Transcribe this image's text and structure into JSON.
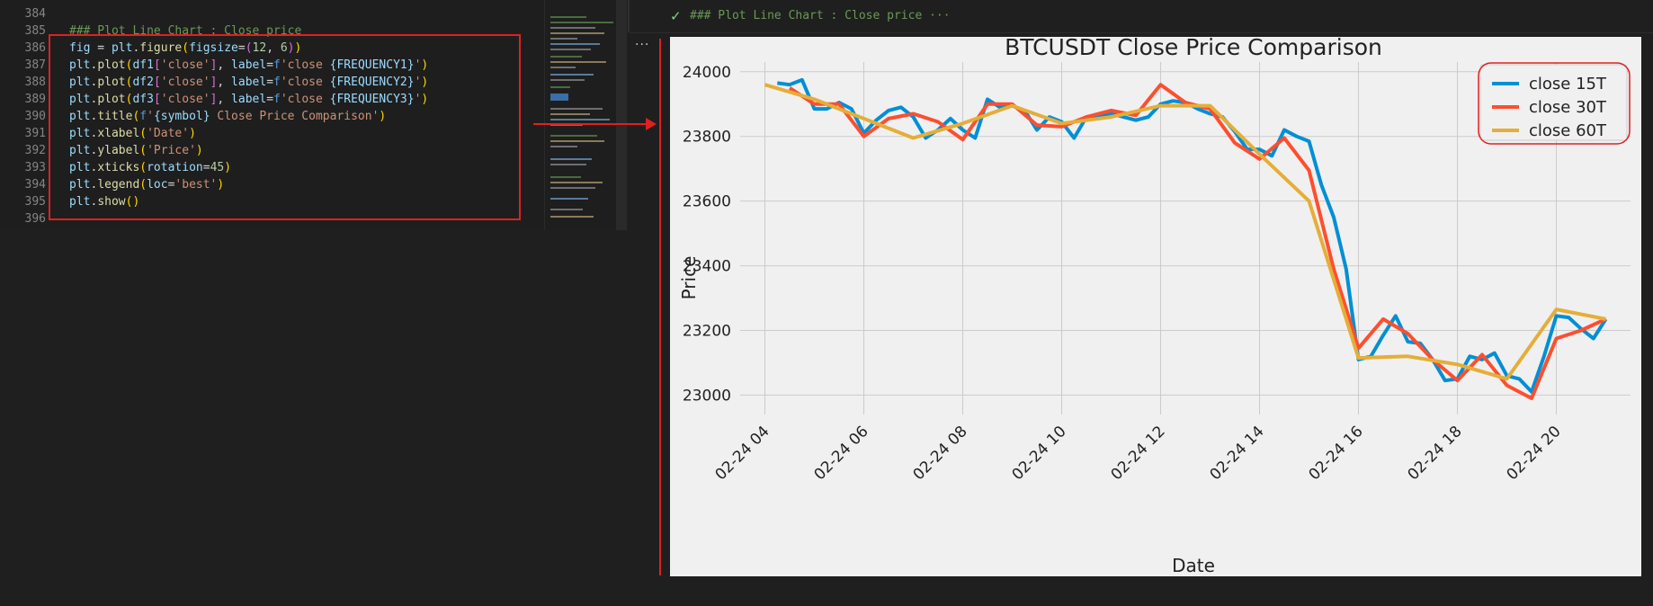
{
  "editor": {
    "lines": [
      {
        "num": "384",
        "tokens": []
      },
      {
        "num": "385",
        "tokens": [
          {
            "t": "### Plot Line Chart : Close price",
            "c": "c-comment"
          }
        ]
      },
      {
        "num": "386",
        "tokens": [
          {
            "t": "fig",
            "c": "c-var"
          },
          {
            "t": " = ",
            "c": "c-punc"
          },
          {
            "t": "plt",
            "c": "c-var"
          },
          {
            "t": ".",
            "c": "c-punc"
          },
          {
            "t": "figure",
            "c": "c-fn"
          },
          {
            "t": "(",
            "c": "c-brace"
          },
          {
            "t": "figsize",
            "c": "c-var"
          },
          {
            "t": "=",
            "c": "c-punc"
          },
          {
            "t": "(",
            "c": "c-brace2"
          },
          {
            "t": "12",
            "c": "c-num"
          },
          {
            "t": ", ",
            "c": "c-punc"
          },
          {
            "t": "6",
            "c": "c-num"
          },
          {
            "t": ")",
            "c": "c-brace2"
          },
          {
            "t": ")",
            "c": "c-brace"
          }
        ]
      },
      {
        "num": "387",
        "tokens": [
          {
            "t": "plt",
            "c": "c-var"
          },
          {
            "t": ".",
            "c": "c-punc"
          },
          {
            "t": "plot",
            "c": "c-fn"
          },
          {
            "t": "(",
            "c": "c-brace"
          },
          {
            "t": "df1",
            "c": "c-var"
          },
          {
            "t": "[",
            "c": "c-brace2"
          },
          {
            "t": "'close'",
            "c": "c-str"
          },
          {
            "t": "]",
            "c": "c-brace2"
          },
          {
            "t": ", ",
            "c": "c-punc"
          },
          {
            "t": "label",
            "c": "c-var"
          },
          {
            "t": "=",
            "c": "c-punc"
          },
          {
            "t": "f",
            "c": "c-kw"
          },
          {
            "t": "'close ",
            "c": "c-str"
          },
          {
            "t": "{FREQUENCY1}",
            "c": "c-fvar"
          },
          {
            "t": "'",
            "c": "c-str"
          },
          {
            "t": ")",
            "c": "c-brace"
          }
        ]
      },
      {
        "num": "388",
        "tokens": [
          {
            "t": "plt",
            "c": "c-var"
          },
          {
            "t": ".",
            "c": "c-punc"
          },
          {
            "t": "plot",
            "c": "c-fn"
          },
          {
            "t": "(",
            "c": "c-brace"
          },
          {
            "t": "df2",
            "c": "c-var"
          },
          {
            "t": "[",
            "c": "c-brace2"
          },
          {
            "t": "'close'",
            "c": "c-str"
          },
          {
            "t": "]",
            "c": "c-brace2"
          },
          {
            "t": ", ",
            "c": "c-punc"
          },
          {
            "t": "label",
            "c": "c-var"
          },
          {
            "t": "=",
            "c": "c-punc"
          },
          {
            "t": "f",
            "c": "c-kw"
          },
          {
            "t": "'close ",
            "c": "c-str"
          },
          {
            "t": "{FREQUENCY2}",
            "c": "c-fvar"
          },
          {
            "t": "'",
            "c": "c-str"
          },
          {
            "t": ")",
            "c": "c-brace"
          }
        ]
      },
      {
        "num": "389",
        "tokens": [
          {
            "t": "plt",
            "c": "c-var"
          },
          {
            "t": ".",
            "c": "c-punc"
          },
          {
            "t": "plot",
            "c": "c-fn"
          },
          {
            "t": "(",
            "c": "c-brace"
          },
          {
            "t": "df3",
            "c": "c-var"
          },
          {
            "t": "[",
            "c": "c-brace2"
          },
          {
            "t": "'close'",
            "c": "c-str"
          },
          {
            "t": "]",
            "c": "c-brace2"
          },
          {
            "t": ", ",
            "c": "c-punc"
          },
          {
            "t": "label",
            "c": "c-var"
          },
          {
            "t": "=",
            "c": "c-punc"
          },
          {
            "t": "f",
            "c": "c-kw"
          },
          {
            "t": "'close ",
            "c": "c-str"
          },
          {
            "t": "{FREQUENCY3}",
            "c": "c-fvar"
          },
          {
            "t": "'",
            "c": "c-str"
          },
          {
            "t": ")",
            "c": "c-brace"
          }
        ]
      },
      {
        "num": "390",
        "tokens": [
          {
            "t": "plt",
            "c": "c-var"
          },
          {
            "t": ".",
            "c": "c-punc"
          },
          {
            "t": "title",
            "c": "c-fn"
          },
          {
            "t": "(",
            "c": "c-brace"
          },
          {
            "t": "f",
            "c": "c-kw"
          },
          {
            "t": "'",
            "c": "c-str"
          },
          {
            "t": "{symbol}",
            "c": "c-fvar"
          },
          {
            "t": " Close Price Comparison'",
            "c": "c-str"
          },
          {
            "t": ")",
            "c": "c-brace"
          }
        ]
      },
      {
        "num": "391",
        "tokens": [
          {
            "t": "plt",
            "c": "c-var"
          },
          {
            "t": ".",
            "c": "c-punc"
          },
          {
            "t": "xlabel",
            "c": "c-fn"
          },
          {
            "t": "(",
            "c": "c-brace"
          },
          {
            "t": "'Date'",
            "c": "c-str"
          },
          {
            "t": ")",
            "c": "c-brace"
          }
        ]
      },
      {
        "num": "392",
        "tokens": [
          {
            "t": "plt",
            "c": "c-var"
          },
          {
            "t": ".",
            "c": "c-punc"
          },
          {
            "t": "ylabel",
            "c": "c-fn"
          },
          {
            "t": "(",
            "c": "c-brace"
          },
          {
            "t": "'Price'",
            "c": "c-str"
          },
          {
            "t": ")",
            "c": "c-brace"
          }
        ]
      },
      {
        "num": "393",
        "tokens": [
          {
            "t": "plt",
            "c": "c-var"
          },
          {
            "t": ".",
            "c": "c-punc"
          },
          {
            "t": "xticks",
            "c": "c-fn"
          },
          {
            "t": "(",
            "c": "c-brace"
          },
          {
            "t": "rotation",
            "c": "c-var"
          },
          {
            "t": "=",
            "c": "c-punc"
          },
          {
            "t": "45",
            "c": "c-num"
          },
          {
            "t": ")",
            "c": "c-brace"
          }
        ]
      },
      {
        "num": "394",
        "tokens": [
          {
            "t": "plt",
            "c": "c-var"
          },
          {
            "t": ".",
            "c": "c-punc"
          },
          {
            "t": "legend",
            "c": "c-fn"
          },
          {
            "t": "(",
            "c": "c-brace"
          },
          {
            "t": "loc",
            "c": "c-var"
          },
          {
            "t": "=",
            "c": "c-punc"
          },
          {
            "t": "'best'",
            "c": "c-str"
          },
          {
            "t": ")",
            "c": "c-brace"
          }
        ]
      },
      {
        "num": "395",
        "tokens": [
          {
            "t": "plt",
            "c": "c-var"
          },
          {
            "t": ".",
            "c": "c-punc"
          },
          {
            "t": "show",
            "c": "c-fn"
          },
          {
            "t": "()",
            "c": "c-brace"
          }
        ]
      },
      {
        "num": "396",
        "tokens": []
      }
    ]
  },
  "output": {
    "header_title": "### Plot Line Chart : Close price ···",
    "more_label": "···"
  },
  "colors": {
    "accent_red": "#e02020",
    "series_15T": "#008fd5",
    "series_30T": "#fc4f30",
    "series_60T": "#e5ae38"
  },
  "chart_data": {
    "type": "line",
    "title": "BTCUSDT Close Price Comparison",
    "xlabel": "Date",
    "ylabel": "Price",
    "x_tick_labels": [
      "02-24 04",
      "02-24 06",
      "02-24 08",
      "02-24 10",
      "02-24 12",
      "02-24 14",
      "02-24 16",
      "02-24 18",
      "02-24 20"
    ],
    "x_tick_hours": [
      4,
      6,
      8,
      10,
      12,
      14,
      16,
      18,
      20
    ],
    "y_ticks": [
      23000,
      23200,
      23400,
      23600,
      23800,
      24000
    ],
    "xlim": [
      3.5,
      21.5
    ],
    "ylim": [
      22940,
      24030
    ],
    "grid": true,
    "legend_position": "top-right",
    "series": [
      {
        "name": "close 15T",
        "color": "#008fd5",
        "x": [
          4.25,
          4.5,
          4.75,
          5.0,
          5.25,
          5.5,
          5.75,
          6.0,
          6.25,
          6.5,
          6.75,
          7.0,
          7.25,
          7.5,
          7.75,
          8.0,
          8.25,
          8.5,
          8.75,
          9.0,
          9.25,
          9.5,
          9.75,
          10.0,
          10.25,
          10.5,
          10.75,
          11.0,
          11.25,
          11.5,
          11.75,
          12.0,
          12.25,
          12.5,
          12.75,
          13.0,
          13.25,
          13.5,
          13.75,
          14.0,
          14.25,
          14.5,
          14.75,
          15.0,
          15.25,
          15.5,
          15.75,
          16.0,
          16.25,
          16.5,
          16.75,
          17.0,
          17.25,
          17.5,
          17.75,
          18.0,
          18.25,
          18.5,
          18.75,
          19.0,
          19.25,
          19.5,
          19.75,
          20.0,
          20.25,
          20.5,
          20.75,
          21.0
        ],
        "values": [
          23965,
          23960,
          23975,
          23885,
          23885,
          23905,
          23885,
          23810,
          23850,
          23880,
          23890,
          23860,
          23795,
          23820,
          23855,
          23820,
          23795,
          23915,
          23890,
          23895,
          23880,
          23820,
          23860,
          23845,
          23795,
          23860,
          23865,
          23870,
          23860,
          23850,
          23860,
          23900,
          23910,
          23905,
          23885,
          23870,
          23860,
          23815,
          23760,
          23760,
          23740,
          23820,
          23800,
          23785,
          23650,
          23550,
          23390,
          23110,
          23120,
          23185,
          23245,
          23165,
          23160,
          23110,
          23045,
          23050,
          23120,
          23110,
          23130,
          23060,
          23050,
          23010,
          23120,
          23245,
          23240,
          23205,
          23175,
          23235
        ]
      },
      {
        "name": "close 30T",
        "color": "#fc4f30",
        "x": [
          4.5,
          5.0,
          5.5,
          6.0,
          6.5,
          7.0,
          7.5,
          8.0,
          8.5,
          9.0,
          9.5,
          10.0,
          10.5,
          11.0,
          11.5,
          12.0,
          12.5,
          13.0,
          13.5,
          14.0,
          14.5,
          15.0,
          15.5,
          16.0,
          16.5,
          17.0,
          17.5,
          18.0,
          18.5,
          19.0,
          19.5,
          20.0,
          20.5,
          21.0
        ],
        "values": [
          23950,
          23900,
          23900,
          23800,
          23855,
          23870,
          23845,
          23790,
          23900,
          23900,
          23835,
          23830,
          23860,
          23880,
          23865,
          23960,
          23905,
          23885,
          23780,
          23730,
          23795,
          23695,
          23390,
          23145,
          23235,
          23190,
          23110,
          23045,
          23125,
          23030,
          22990,
          23175,
          23200,
          23235
        ]
      },
      {
        "name": "close 60T",
        "color": "#e5ae38",
        "x": [
          4.0,
          5.0,
          6.0,
          7.0,
          8.0,
          9.0,
          10.0,
          11.0,
          12.0,
          13.0,
          14.0,
          15.0,
          16.0,
          17.0,
          18.0,
          19.0,
          20.0,
          21.0
        ],
        "values": [
          23960,
          23915,
          23855,
          23795,
          23840,
          23895,
          23840,
          23860,
          23895,
          23895,
          23745,
          23600,
          23115,
          23120,
          23095,
          23050,
          23265,
          23235
        ]
      }
    ]
  }
}
